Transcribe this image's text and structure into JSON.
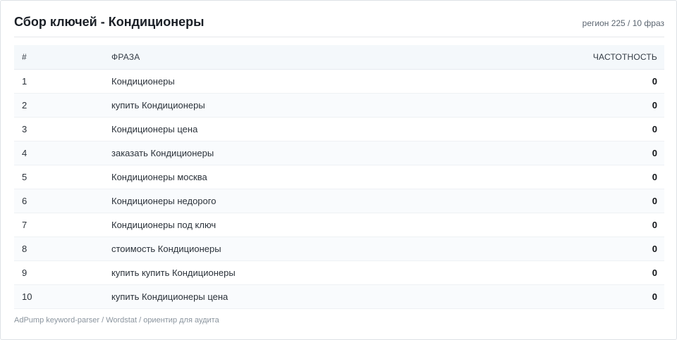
{
  "header": {
    "title": "Сбор ключей - Кондиционеры",
    "meta": "регион 225 / 10 фраз"
  },
  "table": {
    "columns": [
      "#",
      "ФРАЗА",
      "ЧАСТОТНОСТЬ"
    ],
    "rows": [
      {
        "num": "1",
        "phrase": "Кондиционеры",
        "freq": "0"
      },
      {
        "num": "2",
        "phrase": "купить Кондиционеры",
        "freq": "0"
      },
      {
        "num": "3",
        "phrase": "Кондиционеры цена",
        "freq": "0"
      },
      {
        "num": "4",
        "phrase": "заказать Кондиционеры",
        "freq": "0"
      },
      {
        "num": "5",
        "phrase": "Кондиционеры москва",
        "freq": "0"
      },
      {
        "num": "6",
        "phrase": "Кондиционеры недорого",
        "freq": "0"
      },
      {
        "num": "7",
        "phrase": "Кондиционеры под ключ",
        "freq": "0"
      },
      {
        "num": "8",
        "phrase": "стоимость Кондиционеры",
        "freq": "0"
      },
      {
        "num": "9",
        "phrase": "купить купить Кондиционеры",
        "freq": "0"
      },
      {
        "num": "10",
        "phrase": "купить Кондиционеры цена",
        "freq": "0"
      }
    ]
  },
  "footer": {
    "text": "AdPump keyword-parser / Wordstat / ориентир для аудита"
  }
}
